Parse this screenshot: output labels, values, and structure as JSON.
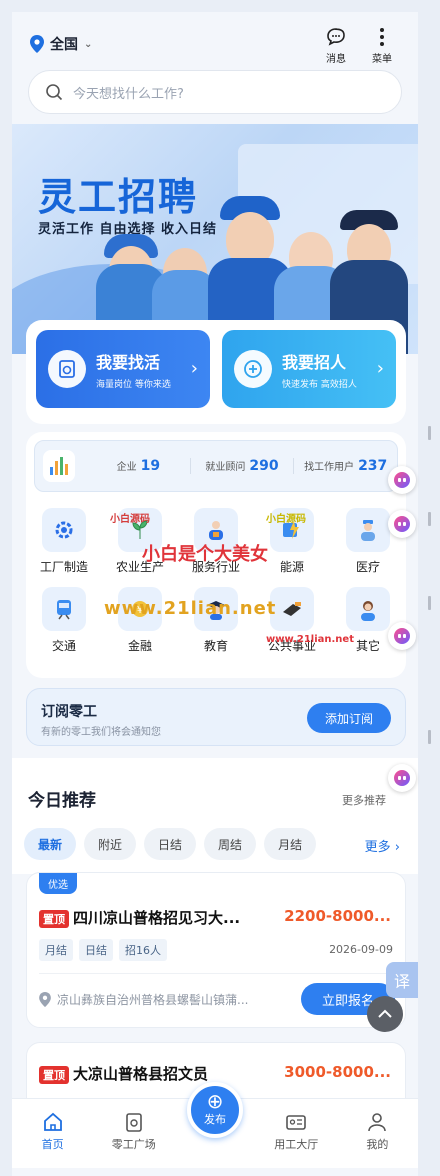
{
  "header": {
    "location": "全国",
    "search_placeholder": "今天想找什么工作?",
    "messages_label": "消息",
    "menu_label": "菜单"
  },
  "banner": {
    "title": "灵工招聘",
    "subtitle": "灵活工作 自由选择 收入日结"
  },
  "actions": [
    {
      "title": "我要找活",
      "desc": "海量岗位 等你来选"
    },
    {
      "title": "我要招人",
      "desc": "快速发布 高效招人"
    }
  ],
  "stats": [
    {
      "label": "企业",
      "value": "19"
    },
    {
      "label": "就业顾问",
      "value": "290"
    },
    {
      "label": "找工作用户",
      "value": "237"
    }
  ],
  "categories": [
    "工厂制造",
    "农业生产",
    "服务行业",
    "能源",
    "医疗",
    "交通",
    "金融",
    "教育",
    "公共事业",
    "其它"
  ],
  "subscribe": {
    "title": "订阅零工",
    "desc": "有新的零工我们将会通知您",
    "button": "添加订阅"
  },
  "recommend": {
    "title": "今日推荐",
    "more": "更多推荐",
    "more_chip": "更多",
    "tabs": [
      "最新",
      "附近",
      "日结",
      "周结",
      "月结"
    ]
  },
  "jobs": [
    {
      "badge": "优选",
      "top_tag": "置顶",
      "title": "四川凉山普格招见习大...",
      "salary": "2200-8000...",
      "tags": [
        "月结",
        "日结",
        "招16人"
      ],
      "date": "2026-09-09",
      "address": "凉山彝族自治州普格县螺髻山镇蒲...",
      "apply": "立即报名"
    },
    {
      "top_tag": "置顶",
      "title": "大凉山普格县招文员",
      "salary": "3000-8000..."
    }
  ],
  "nav": {
    "home": "首页",
    "square": "零工广场",
    "publish": "发布",
    "hall": "用工大厅",
    "mine": "我的"
  },
  "floating": {
    "translate": "译"
  },
  "watermarks": {
    "w1": "小白源码",
    "w2": "www.21lian.net",
    "w3": "小白是个大美女",
    "w4": "小白源码",
    "w5": "www.21lian.net"
  },
  "colors": {
    "primary": "#2e7ff0",
    "salary": "#ef5a2a",
    "top_tag": "#e3322e"
  }
}
